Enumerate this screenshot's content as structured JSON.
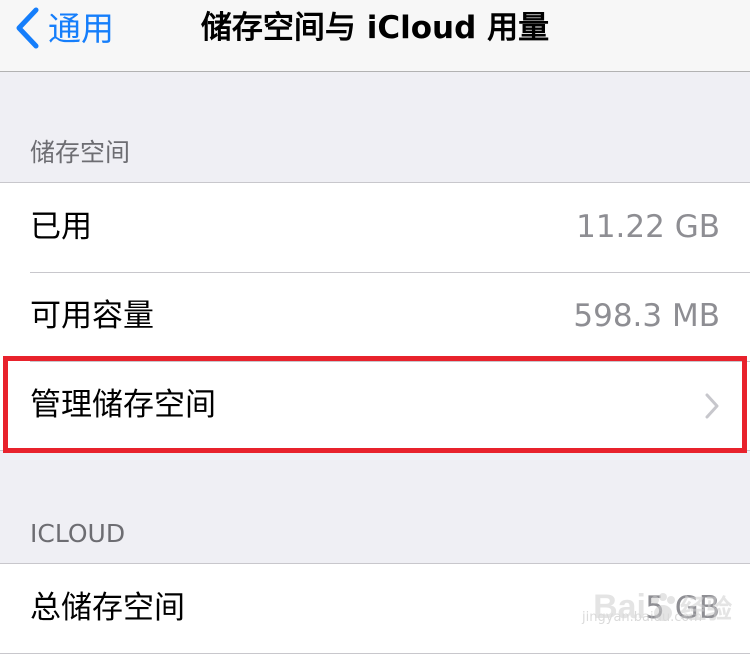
{
  "nav": {
    "back_label": "通用",
    "title": "储存空间与 iCloud 用量"
  },
  "storage": {
    "header": "储存空间",
    "rows": [
      {
        "label": "已用",
        "value": "11.22 GB"
      },
      {
        "label": "可用容量",
        "value": "598.3 MB"
      },
      {
        "label": "管理储存空间"
      }
    ]
  },
  "icloud": {
    "header": "ICLOUD",
    "rows": [
      {
        "label": "总储存空间",
        "value": "5 GB"
      }
    ]
  },
  "watermark": {
    "text": "Bai",
    "text2": "经验",
    "sub": "jingyan.baidu.com"
  },
  "colors": {
    "accent": "#157efb",
    "highlight": "#e8222c"
  },
  "icons": {
    "back": "chevron-left-icon",
    "disclosure": "chevron-right-icon"
  }
}
